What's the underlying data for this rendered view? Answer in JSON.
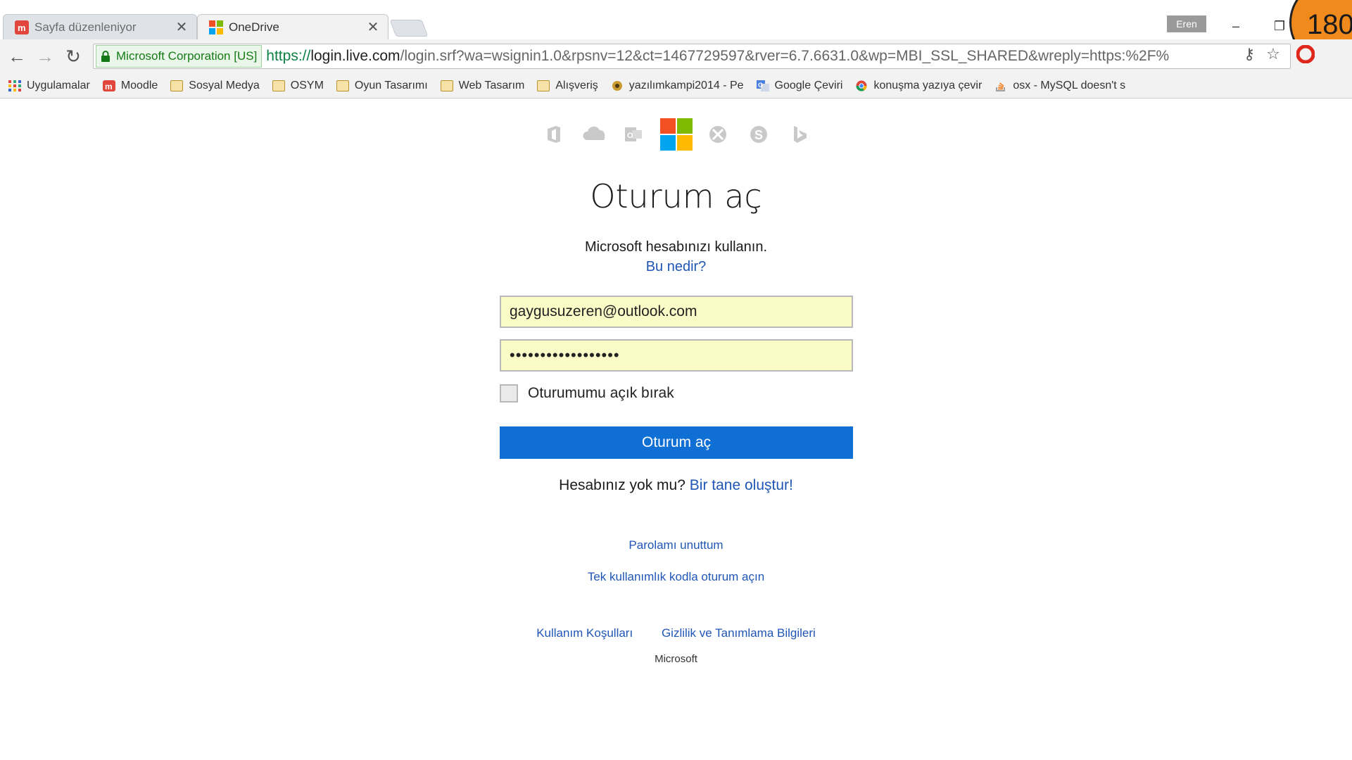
{
  "browser": {
    "tabs": [
      {
        "title": "Sayfa düzenleniyor",
        "active": false
      },
      {
        "title": "OneDrive",
        "active": true
      }
    ],
    "user_badge": "Eren",
    "overlay_badge": "180",
    "address": {
      "ev_label": "Microsoft Corporation [US]",
      "scheme": "https://",
      "host": "login.live.com",
      "path": "/login.srf?wa=wsignin1.0&rpsnv=12&ct=1467729597&rver=6.7.6631.0&wp=MBI_SSL_SHARED&wreply=https:%2F%"
    },
    "bookmarks": [
      {
        "label": "Uygulamalar",
        "icon": "apps-grid-icon"
      },
      {
        "label": "Moodle",
        "icon": "moodle-icon"
      },
      {
        "label": "Sosyal Medya",
        "icon": "folder-icon"
      },
      {
        "label": "OSYM",
        "icon": "folder-icon"
      },
      {
        "label": "Oyun Tasarımı",
        "icon": "folder-icon"
      },
      {
        "label": "Web Tasarım",
        "icon": "folder-icon"
      },
      {
        "label": "Alışveriş",
        "icon": "folder-icon"
      },
      {
        "label": "yazılımkampi2014 - Pe",
        "icon": "badge-icon"
      },
      {
        "label": "Google Çeviri",
        "icon": "translate-icon"
      },
      {
        "label": "konuşma yazıya çevir",
        "icon": "chrome-icon"
      },
      {
        "label": "osx - MySQL doesn't s",
        "icon": "stackoverflow-icon"
      }
    ]
  },
  "colors": {
    "accent": "#0f6fd4",
    "link": "#1f56b5",
    "ms_red": "#f25022",
    "ms_green": "#7fba00",
    "ms_blue": "#00a4ef",
    "ms_yellow": "#ffb900"
  },
  "page": {
    "title": "Oturum aç",
    "subtitle": "Microsoft hesabınızı kullanın.",
    "what_is_this": "Bu nedir?",
    "email_value": "gaygusuzeren@outlook.com",
    "password_value": "••••••••••••••••••",
    "keep_signed_in": "Oturumumu açık bırak",
    "signin_button": "Oturum aç",
    "no_account": "Hesabınız yok mu?",
    "create_one": "Bir tane oluştur!",
    "forgot_password": "Parolamı unuttum",
    "one_time_code": "Tek kullanımlık kodla oturum açın",
    "terms": "Kullanım Koşulları",
    "privacy": "Gizlilik ve Tanımlama Bilgileri",
    "copyright": "Microsoft"
  }
}
